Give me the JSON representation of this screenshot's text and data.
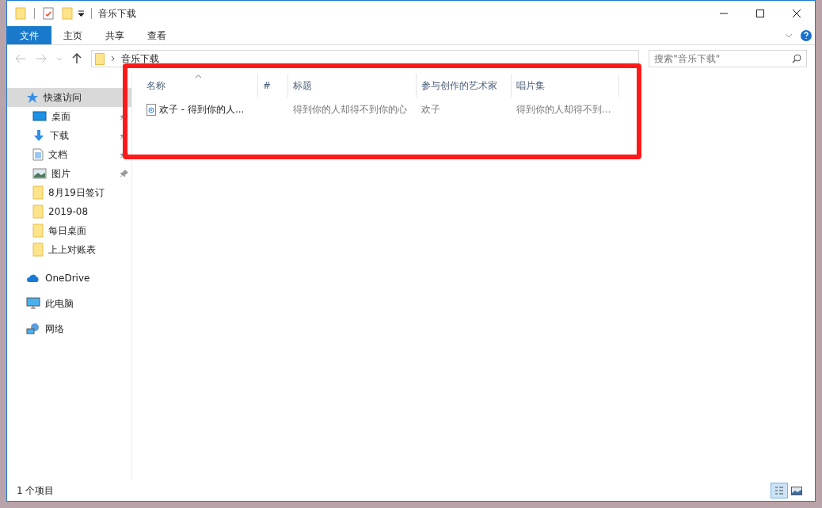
{
  "window": {
    "title": "音乐下载"
  },
  "ribbon_tabs": [
    {
      "label": "文件",
      "selected": true
    },
    {
      "label": "主页",
      "selected": false
    },
    {
      "label": "共享",
      "selected": false
    },
    {
      "label": "查看",
      "selected": false
    }
  ],
  "address": {
    "path": "音乐下载"
  },
  "search": {
    "placeholder": "搜索\"音乐下载\""
  },
  "sidebar": {
    "items": [
      {
        "label": "快速访问",
        "kind": "quick",
        "selected": true,
        "pinned": false
      },
      {
        "label": "桌面",
        "kind": "desktop",
        "selected": false,
        "pinned": true
      },
      {
        "label": "下载",
        "kind": "download",
        "selected": false,
        "pinned": true
      },
      {
        "label": "文档",
        "kind": "document",
        "selected": false,
        "pinned": true
      },
      {
        "label": "图片",
        "kind": "picture",
        "selected": false,
        "pinned": true
      },
      {
        "label": "8月19日签订",
        "kind": "folder",
        "selected": false,
        "pinned": false
      },
      {
        "label": "2019-08",
        "kind": "folder",
        "selected": false,
        "pinned": false
      },
      {
        "label": "每日桌面",
        "kind": "folder",
        "selected": false,
        "pinned": false
      },
      {
        "label": "上上对账表",
        "kind": "folder",
        "selected": false,
        "pinned": false
      },
      {
        "label": "OneDrive",
        "kind": "cloud",
        "selected": false,
        "pinned": false
      },
      {
        "label": "此电脑",
        "kind": "pc",
        "selected": false,
        "pinned": false
      },
      {
        "label": "网络",
        "kind": "network",
        "selected": false,
        "pinned": false
      }
    ]
  },
  "table": {
    "columns": [
      "名称",
      "#",
      "标题",
      "参与创作的艺术家",
      "唱片集"
    ],
    "rows": [
      {
        "cells": [
          "欢子 - 得到你的人...",
          "",
          "得到你的人却得不到你的心",
          "欢子",
          "得到你的人却得不到..."
        ]
      }
    ]
  },
  "status_bar": {
    "text": "1 个项目"
  },
  "annotation": {
    "kind": "red-rectangle"
  }
}
